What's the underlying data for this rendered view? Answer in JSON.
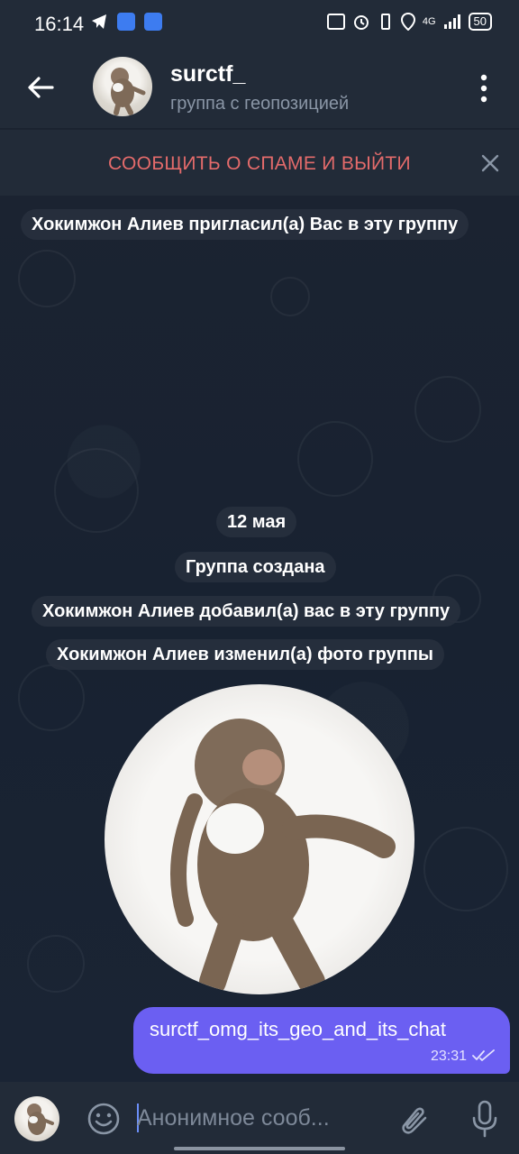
{
  "status_bar": {
    "time": "16:14",
    "battery": "50",
    "network": "4G"
  },
  "header": {
    "title": "surctf_",
    "subtitle": "группа с геопозицией"
  },
  "spam_bar": {
    "label": "СООБЩИТЬ О СПАМЕ И ВЫЙТИ"
  },
  "messages": {
    "invite": "Хокимжон Алиев пригласил(а) Вас в эту группу",
    "date": "12 мая",
    "created": "Группа создана",
    "added": "Хокимжон Алиев добавил(а) вас в эту группу",
    "photo_changed": "Хокимжон Алиев изменил(а) фото группы",
    "outgoing": {
      "text": "surctf_omg_its_geo_and_its_chat",
      "time": "23:31",
      "status_icon": "double-check-icon"
    }
  },
  "input": {
    "placeholder": "Анонимное сооб..."
  },
  "colors": {
    "spam_red": "#e46b6b",
    "bubble": "#6b5ff2",
    "bar_bg": "#222b38"
  }
}
